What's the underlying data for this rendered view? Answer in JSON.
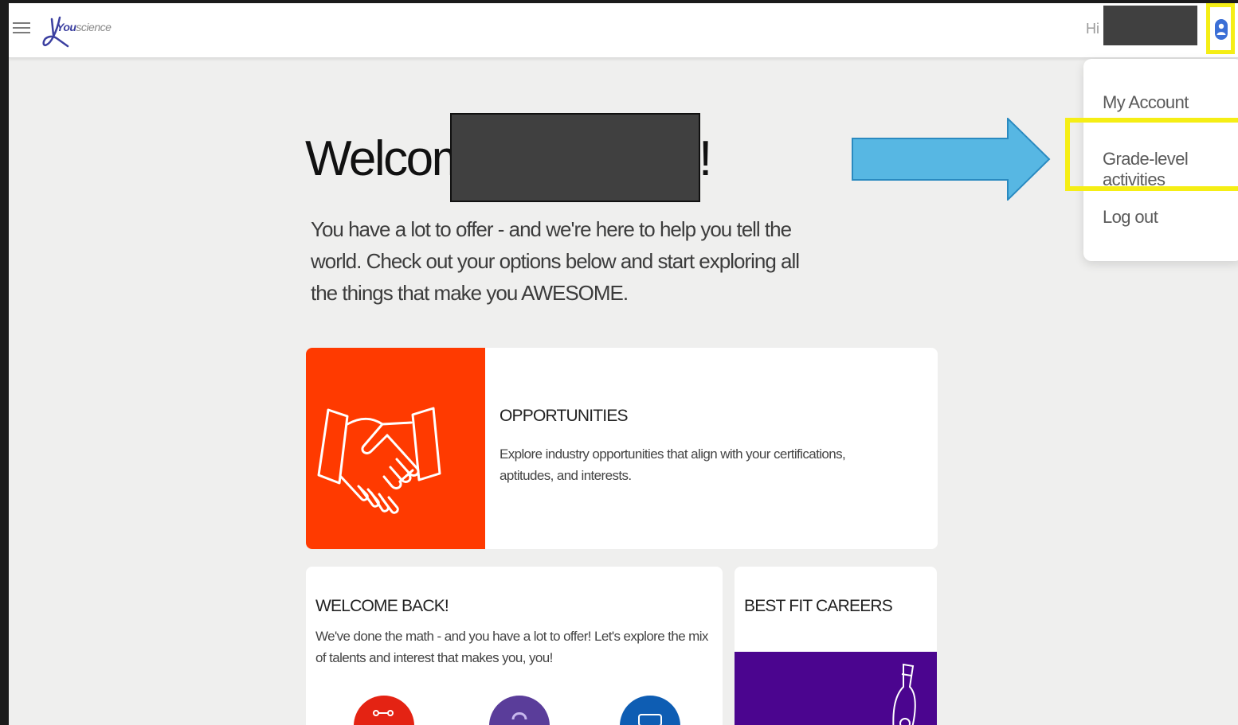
{
  "header": {
    "logo_text_brand": "You",
    "logo_text_rest": "science",
    "greeting": "Hi"
  },
  "user_menu": {
    "items": [
      {
        "label": "My Account"
      },
      {
        "label": "Grade-level activities"
      },
      {
        "label": "Log out"
      }
    ]
  },
  "main": {
    "welcome": "Welcome,",
    "welcome_end": "!",
    "intro": "You have a lot to offer - and we're here to help you tell the world. Check out your options below and start exploring all the things that make you AWESOME."
  },
  "cards": {
    "opportunities": {
      "title": "OPPORTUNITIES",
      "description": "Explore industry opportunities that align with your certifications, aptitudes, and interests.",
      "icon": "handshake-icon",
      "color": "#ff3a00"
    },
    "welcome_back": {
      "title": "WELCOME BACK!",
      "description": "We've done the math - and you have a lot to offer! Let's explore the mix of talents and interest that makes you, you!"
    },
    "best_fit": {
      "title": "BEST FIT CAREERS",
      "color": "#4b058f"
    }
  },
  "colors": {
    "highlight": "#f5ee15",
    "arrow": "#57b7e3"
  }
}
